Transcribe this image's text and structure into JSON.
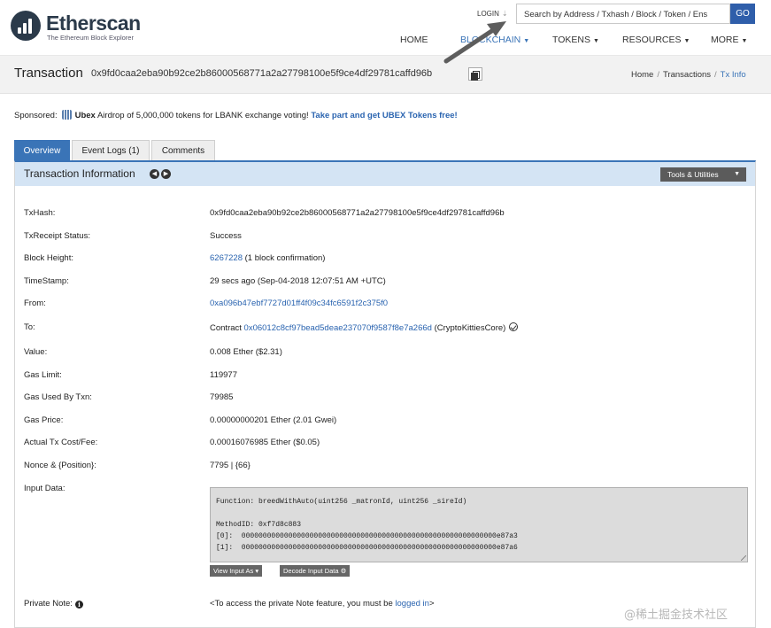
{
  "header": {
    "logo_title": "Etherscan",
    "logo_subtitle": "The Ethereum Block Explorer",
    "login": "LOGIN",
    "search_placeholder": "Search by Address / Txhash / Block / Token / Ens",
    "go_label": "GO",
    "nav": [
      {
        "label": "HOME",
        "dropdown": false
      },
      {
        "label": "BLOCKCHAIN",
        "dropdown": true
      },
      {
        "label": "TOKENS",
        "dropdown": true
      },
      {
        "label": "RESOURCES",
        "dropdown": true
      },
      {
        "label": "MORE",
        "dropdown": true
      }
    ],
    "active_nav": "BLOCKCHAIN"
  },
  "title": {
    "label": "Transaction",
    "hash": "0x9fd0caa2eba90b92ce2b86000568771a2a27798100e5f9ce4df29781caffd96b"
  },
  "breadcrumb": [
    "Home",
    "Transactions",
    "Tx Info"
  ],
  "sponsored": {
    "prefix": "Sponsored:",
    "brand": "Ubex",
    "text": "Airdrop of 5,000,000 tokens for LBANK exchange voting!",
    "link": "Take part and get UBEX Tokens free!"
  },
  "tabs": [
    "Overview",
    "Event Logs (1)",
    "Comments"
  ],
  "panel": {
    "title": "Transaction Information",
    "tools_label": "Tools & Utilities"
  },
  "fields": {
    "txhash": {
      "label": "TxHash:",
      "value": "0x9fd0caa2eba90b92ce2b86000568771a2a27798100e5f9ce4df29781caffd96b"
    },
    "status": {
      "label": "TxReceipt Status:",
      "value": "Success"
    },
    "block": {
      "label": "Block Height:",
      "link": "6267228",
      "suffix": "(1 block confirmation)"
    },
    "timestamp": {
      "label": "TimeStamp:",
      "value": "29 secs ago (Sep-04-2018 12:07:51 AM +UTC)"
    },
    "from": {
      "label": "From:",
      "link": "0xa096b47ebf7727d01ff4f09c34fc6591f2c375f0"
    },
    "to": {
      "label": "To:",
      "prefix": "Contract",
      "link": "0x06012c8cf97bead5deae237070f9587f8e7a266d",
      "suffix": "(CryptoKittiesCore)"
    },
    "value": {
      "label": "Value:",
      "value": "0.008 Ether ($2.31)"
    },
    "gas_limit": {
      "label": "Gas Limit:",
      "value": "119977"
    },
    "gas_used": {
      "label": "Gas Used By Txn:",
      "value": "79985"
    },
    "gas_price": {
      "label": "Gas Price:",
      "value": "0.00000000201 Ether (2.01 Gwei)"
    },
    "tx_cost": {
      "label": "Actual Tx Cost/Fee:",
      "value": "0.00016076985 Ether ($0.05)"
    },
    "nonce": {
      "label": "Nonce & {Position}:",
      "value": "7795 | {66}"
    },
    "input": {
      "label": "Input Data:"
    },
    "private_note": {
      "label": "Private Note:",
      "prefix": "<To access the private Note feature, you must be",
      "link": "logged in",
      "suffix": ">"
    }
  },
  "input_data": {
    "lines": [
      "Function: breedWithAuto(uint256 _matronId, uint256 _sireId)",
      "",
      "MethodID: 0xf7d8c883",
      "[0]:  000000000000000000000000000000000000000000000000000000000000e87a3",
      "[1]:  000000000000000000000000000000000000000000000000000000000000e87a6"
    ],
    "view_as": "View Input As",
    "decode": "Decode Input Data"
  },
  "watermark": "@稀土掘金技术社区"
}
